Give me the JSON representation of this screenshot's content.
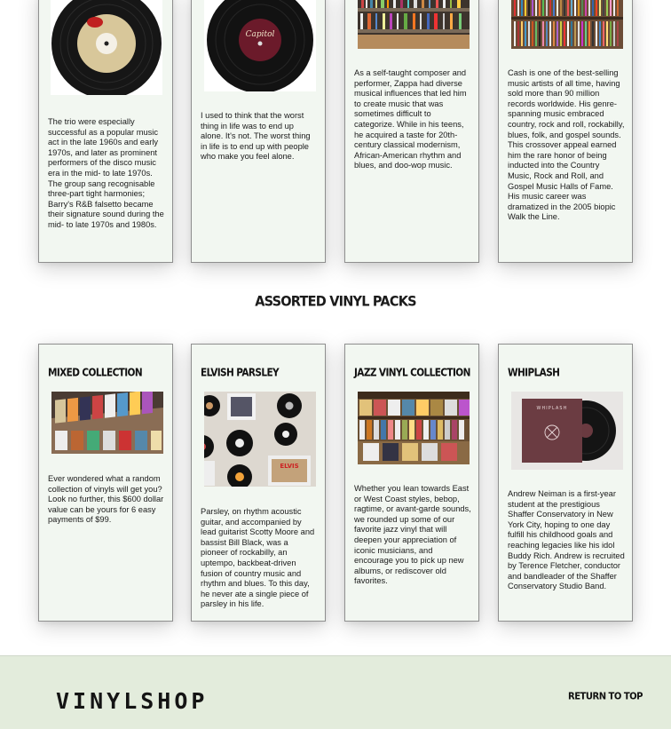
{
  "top_cards": [
    {
      "text": "The trio were especially successful as a popular music act in the late 1960s and early 1970s, and later as prominent performers of the disco music era in the mid- to late 1970s. The group sang recognisable three-part tight harmonies; Barry's R&B falsetto became their signature sound during the mid- to late 1970s and 1980s."
    },
    {
      "text": "I used to think that the worst thing in life was to end up alone. It's not. The worst thing in life is to end up with people who make you feel alone."
    },
    {
      "text": "As a self-taught composer and performer, Zappa had diverse musical influences that led him to create music that was sometimes difficult to categorize. While in his teens, he acquired a taste for 20th-century classical modernism, African-American rhythm and blues, and doo-wop music."
    },
    {
      "text": "Cash is one of the best-selling music artists of all time, having sold more than 90 million records worldwide. His genre-spanning music embraced country, rock and roll, rockabilly, blues, folk, and gospel sounds. This crossover appeal earned him the rare honor of being inducted into the Country Music, Rock and Roll, and Gospel Music Halls of Fame. His music career was dramatized in the 2005 biopic Walk the Line."
    }
  ],
  "section_title": "ASSORTED VINYL PACKS",
  "packs": [
    {
      "title": "MIXED COLLECTION",
      "text": "Ever wondered what a random collection of vinyls will get you? Look no further, this $600 dollar value can be yours for 6 easy payments of $99."
    },
    {
      "title": "ELVISH PARSLEY",
      "text": "Parsley, on rhythm acoustic guitar, and accompanied by lead guitarist Scotty Moore and bassist Bill Black, was a pioneer of rockabilly, an uptempo, backbeat-driven fusion of country music and rhythm and blues. To this day, he never ate a single piece of parsley in his life."
    },
    {
      "title": "JAZZ VINYL COLLECTION",
      "text": "Whether you lean towards East or West Coast styles, bebop, ragtime, or avant-garde sounds, we rounded up some of our favorite jazz vinyl that will deepen your appreciation of iconic musicians, and encourage you to pick up new albums, or rediscover old favorites."
    },
    {
      "title": "WHIPLASH",
      "text": "Andrew Neiman is a first-year student at the prestigious Shaffer Conservatory in New York City, hoping to one day fulfill his childhood goals and reaching legacies like his idol Buddy Rich. Andrew is recruited by Terence Fletcher, conductor and bandleader of the Shaffer Conservatory Studio Band."
    }
  ],
  "footer": {
    "logo": "VINYLSHOP",
    "return_label": "RETURN TO TOP"
  },
  "image_texts": {
    "capitol": "Capitol",
    "whiplash": "WHIPLASH"
  },
  "colors": {
    "card_bg": "#f2f7f1",
    "footer_bg": "#e3ecdc",
    "border": "#8f8f8f"
  }
}
